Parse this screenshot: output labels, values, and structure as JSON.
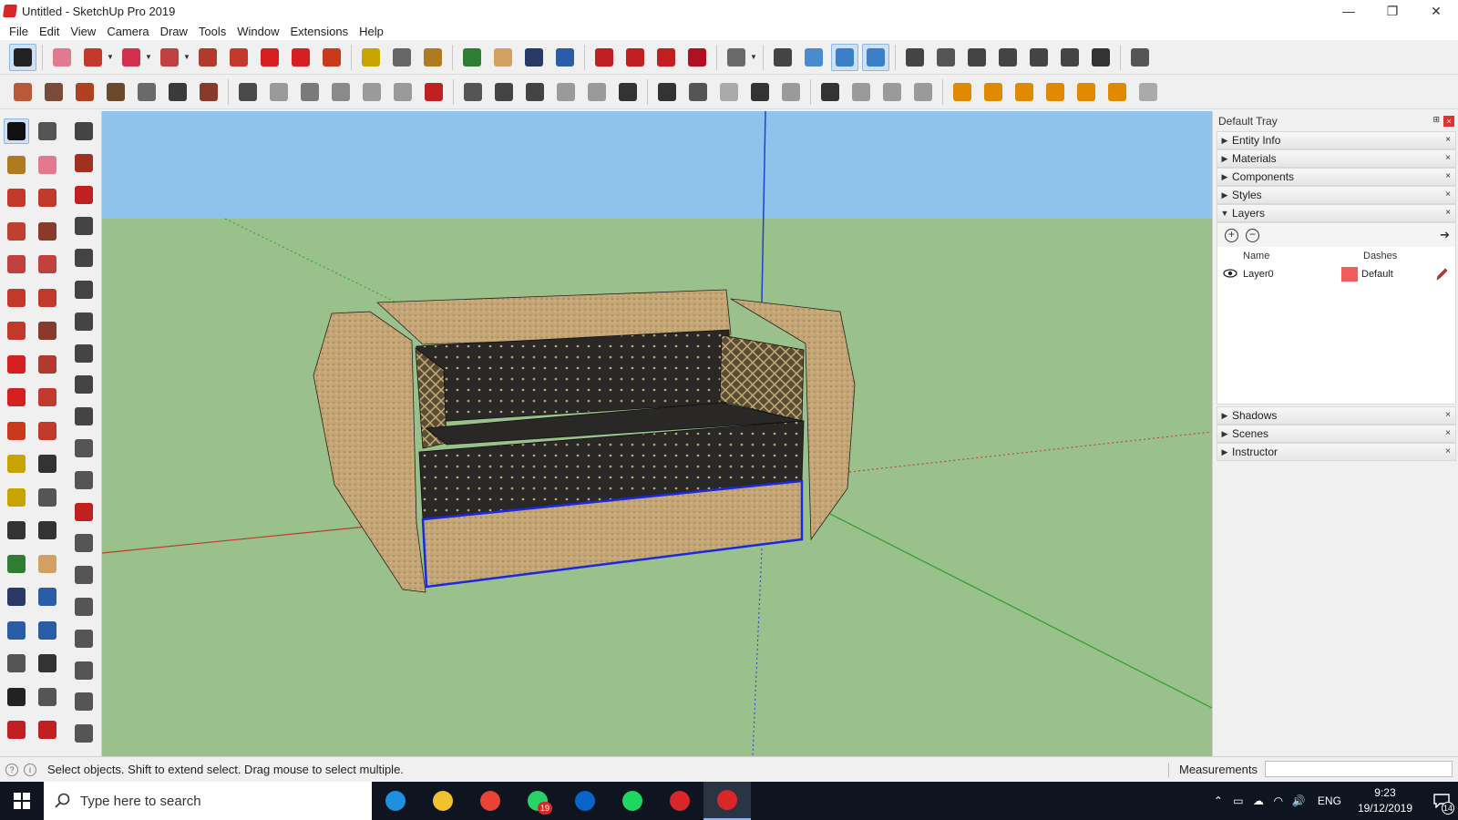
{
  "window": {
    "title": "Untitled - SketchUp Pro 2019",
    "minimize_glyph": "—",
    "maximize_glyph": "❐",
    "close_glyph": "✕"
  },
  "menubar": {
    "items": [
      "File",
      "Edit",
      "View",
      "Camera",
      "Draw",
      "Tools",
      "Window",
      "Extensions",
      "Help"
    ]
  },
  "toolbar1": {
    "tools": [
      {
        "icon": "select-arrow-icon",
        "color": "#222222",
        "active": true
      },
      {
        "icon": "eraser-icon",
        "color": "#e27a8f"
      },
      {
        "icon": "pencil-line-icon",
        "color": "#c0392b",
        "dropdown": true
      },
      {
        "icon": "freehand-arc-icon",
        "color": "#d0324b",
        "dropdown": true
      },
      {
        "icon": "circle-shape-icon",
        "color": "#c04040",
        "dropdown": true
      },
      {
        "icon": "push-pull-icon",
        "color": "#b03a2e"
      },
      {
        "icon": "follow-me-icon",
        "color": "#c0392b"
      },
      {
        "icon": "move-icon",
        "color": "#d42020"
      },
      {
        "icon": "rotate-icon",
        "color": "#d42020"
      },
      {
        "icon": "scale-icon",
        "color": "#c83a1a"
      },
      {
        "icon": "tape-measure-icon",
        "color": "#c9a400"
      },
      {
        "icon": "text-tool-icon",
        "color": "#666666"
      },
      {
        "icon": "paint-bucket-icon",
        "color": "#b07a20"
      },
      {
        "icon": "orbit-icon",
        "color": "#2e7d32"
      },
      {
        "icon": "pan-hand-icon",
        "color": "#d2a060"
      },
      {
        "icon": "zoom-icon",
        "color": "#2a3a66"
      },
      {
        "icon": "zoom-extents-icon",
        "color": "#2a5ca8"
      },
      {
        "icon": "warehouse-icon",
        "color": "#c02020"
      },
      {
        "icon": "share-model-icon",
        "color": "#c02020"
      },
      {
        "icon": "extension-warehouse-icon",
        "color": "#c02020"
      },
      {
        "icon": "ruby-icon",
        "color": "#b01020"
      },
      {
        "icon": "user-account-icon",
        "color": "#6a6a6a",
        "dropdown": true
      },
      {
        "icon": "position-camera-icon",
        "color": "#444444"
      },
      {
        "icon": "iso-view-icon",
        "color": "#4a8ad0"
      },
      {
        "icon": "top-view-icon",
        "color": "#3a7fc8",
        "active": true
      },
      {
        "icon": "front-view-icon",
        "color": "#3a7fc8",
        "active": true
      },
      {
        "icon": "x-ray-icon",
        "color": "#444444"
      },
      {
        "icon": "back-edges-icon",
        "color": "#555555"
      },
      {
        "icon": "wireframe-icon",
        "color": "#444444"
      },
      {
        "icon": "hidden-line-icon",
        "color": "#444444"
      },
      {
        "icon": "shaded-icon",
        "color": "#444444"
      },
      {
        "icon": "shaded-textures-icon",
        "color": "#444444"
      },
      {
        "icon": "monochrome-icon",
        "color": "#333333"
      },
      {
        "icon": "section-plane-icon",
        "color": "#555555"
      }
    ]
  },
  "toolbar2": {
    "tools": [
      {
        "icon": "sandbox-contours-icon",
        "color": "#b85a3a"
      },
      {
        "icon": "sandbox-scratch-icon",
        "color": "#7a4a3a"
      },
      {
        "icon": "smoove-icon",
        "color": "#b04020"
      },
      {
        "icon": "stamp-icon",
        "color": "#6a4a2a"
      },
      {
        "icon": "drape-icon",
        "color": "#6a6a6a"
      },
      {
        "icon": "add-detail-icon",
        "color": "#3a3a3a"
      },
      {
        "icon": "flip-edge-icon",
        "color": "#8a3a2a"
      },
      {
        "icon": "camera-icon",
        "color": "#4a4a4a"
      },
      {
        "icon": "advanced-camera-icon",
        "color": "#9a9a9a"
      },
      {
        "icon": "film-camera-icon",
        "color": "#7a7a7a"
      },
      {
        "icon": "camera-frustum-icon",
        "color": "#8a8a8a"
      },
      {
        "icon": "camera-plane-icon",
        "color": "#9a9a9a"
      },
      {
        "icon": "camera-look-icon",
        "color": "#9a9a9a"
      },
      {
        "icon": "clear-camera-icon",
        "color": "#c02020"
      },
      {
        "icon": "solid-tools-outer-icon",
        "color": "#555555"
      },
      {
        "icon": "solid-union-icon",
        "color": "#444444"
      },
      {
        "icon": "solid-intersect-icon",
        "color": "#444444"
      },
      {
        "icon": "solid-subtract-icon",
        "color": "#9a9a9a"
      },
      {
        "icon": "solid-trim-icon",
        "color": "#9a9a9a"
      },
      {
        "icon": "solid-split-icon",
        "color": "#333333"
      },
      {
        "icon": "dynamic-interact-icon",
        "color": "#333333"
      },
      {
        "icon": "component-options-icon",
        "color": "#555555"
      },
      {
        "icon": "component-attributes-icon",
        "color": "#aaaaaa"
      },
      {
        "icon": "generate-report-icon",
        "color": "#333333"
      },
      {
        "icon": "trimble-connect-icon",
        "color": "#9a9a9a"
      },
      {
        "icon": "layout-send-icon",
        "color": "#333333"
      },
      {
        "icon": "section-cut-icon",
        "color": "#9a9a9a"
      },
      {
        "icon": "section-fill-icon",
        "color": "#9a9a9a"
      },
      {
        "icon": "section-display-icon",
        "color": "#9a9a9a"
      },
      {
        "icon": "3d-text-icon",
        "color": "#e08a00"
      },
      {
        "icon": "dimension-icon",
        "color": "#e08a00"
      },
      {
        "icon": "protractor-icon",
        "color": "#e08a00"
      },
      {
        "icon": "axes-icon",
        "color": "#e08a00"
      },
      {
        "icon": "sun-shadow-icon",
        "color": "#e08a00"
      },
      {
        "icon": "fog-icon",
        "color": "#e08a00"
      },
      {
        "icon": "match-photo-icon",
        "color": "#aaaaaa"
      }
    ]
  },
  "left_palette": {
    "tools": [
      {
        "icon": "select-arrow-icon",
        "color": "#111111",
        "active": true
      },
      {
        "icon": "make-component-icon",
        "color": "#555555"
      },
      {
        "icon": "paint-bucket-icon",
        "color": "#b07a20"
      },
      {
        "icon": "eraser-icon",
        "color": "#e27a8f"
      },
      {
        "icon": "line-tool-icon",
        "color": "#c0392b"
      },
      {
        "icon": "freehand-icon",
        "color": "#c0392b"
      },
      {
        "icon": "rectangle-icon",
        "color": "#c04030"
      },
      {
        "icon": "rotated-rect-icon",
        "color": "#8a3a2a"
      },
      {
        "icon": "circle-icon",
        "color": "#c04040"
      },
      {
        "icon": "polygon-icon",
        "color": "#c04040"
      },
      {
        "icon": "arc-icon",
        "color": "#c0392b"
      },
      {
        "icon": "two-point-arc-icon",
        "color": "#c0392b"
      },
      {
        "icon": "three-point-arc-icon",
        "color": "#c0392b"
      },
      {
        "icon": "pie-icon",
        "color": "#8a3a2a"
      },
      {
        "icon": "move-icon",
        "color": "#d42020"
      },
      {
        "icon": "push-pull-icon",
        "color": "#b03a2e"
      },
      {
        "icon": "rotate-icon",
        "color": "#d42020"
      },
      {
        "icon": "follow-me-icon",
        "color": "#c0392b"
      },
      {
        "icon": "scale-icon",
        "color": "#c83a1a"
      },
      {
        "icon": "offset-icon",
        "color": "#c0392b"
      },
      {
        "icon": "tape-measure-icon",
        "color": "#c9a400"
      },
      {
        "icon": "dimension-icon",
        "color": "#333333"
      },
      {
        "icon": "protractor-icon",
        "color": "#c9a400"
      },
      {
        "icon": "text-tool-icon",
        "color": "#555555"
      },
      {
        "icon": "axes-icon",
        "color": "#333333"
      },
      {
        "icon": "3d-text-icon",
        "color": "#333333"
      },
      {
        "icon": "orbit-icon",
        "color": "#2e7d32"
      },
      {
        "icon": "pan-hand-icon",
        "color": "#d2a060"
      },
      {
        "icon": "zoom-icon",
        "color": "#2a3a66"
      },
      {
        "icon": "zoom-window-icon",
        "color": "#2a5ca8"
      },
      {
        "icon": "zoom-extents-icon",
        "color": "#2a5ca8"
      },
      {
        "icon": "previous-view-icon",
        "color": "#2a5ca8"
      },
      {
        "icon": "position-camera-icon",
        "color": "#555555"
      },
      {
        "icon": "look-around-icon",
        "color": "#333333"
      },
      {
        "icon": "walk-icon",
        "color": "#222222"
      },
      {
        "icon": "section-plane-icon",
        "color": "#555555"
      },
      {
        "icon": "warehouse-icon",
        "color": "#c02020"
      },
      {
        "icon": "extension-warehouse-icon",
        "color": "#c02020"
      }
    ],
    "tools_col3": [
      {
        "icon": "sandbox-contours-icon",
        "color": "#444444"
      },
      {
        "icon": "sandbox-scratch-icon",
        "color": "#a03020"
      },
      {
        "icon": "smoove-icon",
        "color": "#c02020"
      },
      {
        "icon": "stamp-icon",
        "color": "#444444"
      },
      {
        "icon": "drape-icon",
        "color": "#444444"
      },
      {
        "icon": "add-detail-icon",
        "color": "#444444"
      },
      {
        "icon": "flip-edge-icon",
        "color": "#444444"
      },
      {
        "icon": "camera-icon",
        "color": "#444444"
      },
      {
        "icon": "advanced-camera-icon",
        "color": "#444444"
      },
      {
        "icon": "film-camera-icon",
        "color": "#444444"
      },
      {
        "icon": "camera-frustum-icon",
        "color": "#555555"
      },
      {
        "icon": "camera-plane-icon",
        "color": "#555555"
      },
      {
        "icon": "camera-look-icon",
        "color": "#c02020"
      },
      {
        "icon": "clear-camera-icon",
        "color": "#555555"
      },
      {
        "icon": "solid-union-icon",
        "color": "#555555"
      },
      {
        "icon": "solid-intersect-icon",
        "color": "#555555"
      },
      {
        "icon": "solid-subtract-icon",
        "color": "#555555"
      },
      {
        "icon": "solid-trim-icon",
        "color": "#555555"
      },
      {
        "icon": "solid-split-icon",
        "color": "#555555"
      },
      {
        "icon": "component-options-icon",
        "color": "#555555"
      }
    ]
  },
  "tray": {
    "title": "Default Tray",
    "pin_glyph": "⊞",
    "close_glyph": "×",
    "panels_top": [
      {
        "label": "Entity Info",
        "expanded": false
      },
      {
        "label": "Materials",
        "expanded": false
      },
      {
        "label": "Components",
        "expanded": false
      },
      {
        "label": "Styles",
        "expanded": false
      },
      {
        "label": "Layers",
        "expanded": true
      }
    ],
    "panels_bottom": [
      {
        "label": "Shadows",
        "expanded": false
      },
      {
        "label": "Scenes",
        "expanded": false
      },
      {
        "label": "Instructor",
        "expanded": false
      }
    ],
    "collapsed_glyph": "▶",
    "expanded_glyph": "▼",
    "panel_close_glyph": "×",
    "layers": {
      "add_glyph": "+",
      "remove_glyph": "−",
      "details_glyph": "➔",
      "col_name": "Name",
      "col_dashes": "Dashes",
      "rows": [
        {
          "visible_icon": "eye-icon",
          "name": "Layer0",
          "color": "#f25c5c",
          "dashes": "Default"
        }
      ]
    }
  },
  "viewport": {
    "sky_color": "#8ec4ec",
    "ground_color": "#9ac08c",
    "axis_red": "#c0392b",
    "axis_green": "#27a02a",
    "axis_blue": "#2040d0",
    "selection_color": "#1a28e0",
    "sofa": {
      "fabric_color": "#c4a676",
      "cushion_color": "#2a2826",
      "pillow_color": "#5b4c34"
    }
  },
  "statusbar": {
    "message": "Select objects. Shift to extend select. Drag mouse to select multiple.",
    "measurements_label": "Measurements",
    "geo_icon": "?",
    "info_icon": "i"
  },
  "taskbar": {
    "search_placeholder": "Type here to search",
    "apps": [
      {
        "icon": "edge-browser-icon",
        "color": "#1f8fe0"
      },
      {
        "icon": "file-explorer-icon",
        "color": "#f2c12e"
      },
      {
        "icon": "chrome-icon",
        "color": "#e84335"
      },
      {
        "icon": "whatsapp-icon",
        "color": "#25d366",
        "badge": "19"
      },
      {
        "icon": "outlook-icon",
        "color": "#0a64c8"
      },
      {
        "icon": "spotify-icon",
        "color": "#1ed760"
      },
      {
        "icon": "sketchup-icon",
        "color": "#d9262b"
      },
      {
        "icon": "sketchup-active-icon",
        "color": "#d9262b",
        "active": true
      }
    ],
    "lang": "ENG",
    "time": "9:23",
    "date": "19/12/2019",
    "notifications": "14",
    "tray_icons": [
      "chevron-up-icon",
      "battery-icon",
      "onedrive-icon",
      "wifi-icon",
      "volume-icon"
    ],
    "tray_glyphs": [
      "⌃",
      "▭",
      "☁",
      "◠",
      "🔊"
    ]
  }
}
